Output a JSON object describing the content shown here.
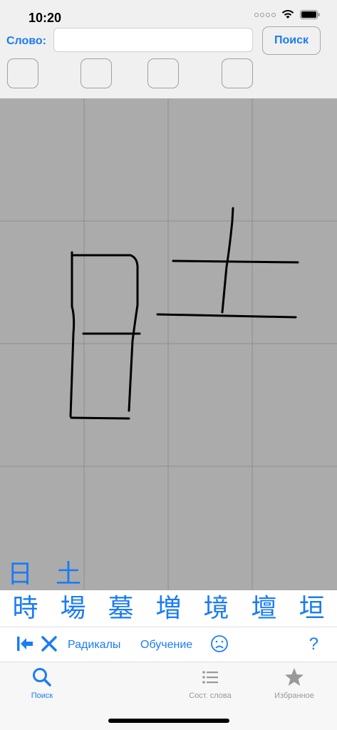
{
  "status_bar": {
    "time": "10:20"
  },
  "search_bar": {
    "word_label": "Слово:",
    "word_value": "",
    "search_button": "Поиск",
    "slots": [
      "",
      "",
      "",
      ""
    ]
  },
  "canvas": {
    "grid": true
  },
  "radicals": [
    "日",
    "土"
  ],
  "candidates": [
    "時",
    "場",
    "墓",
    "増",
    "境",
    "壇",
    "垣"
  ],
  "toolbar": {
    "radicals_label": "Радикалы",
    "learning_label": "Обучение",
    "help": "?"
  },
  "tabs": [
    {
      "label": "Поиск",
      "icon": "search-icon",
      "active": true
    },
    {
      "label": "Сост. слова",
      "icon": "list-icon",
      "active": false
    },
    {
      "label": "Избранное",
      "icon": "star-icon",
      "active": false
    }
  ],
  "colors": {
    "accent": "#1a7cf5",
    "canvas": "#ababab",
    "stroke": "#000000"
  }
}
